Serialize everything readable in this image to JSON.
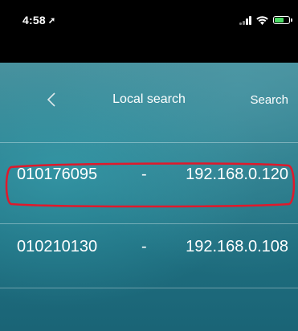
{
  "status_bar": {
    "time": "4:58",
    "location_glyph": "➚",
    "battery_color": "#4cd964"
  },
  "nav": {
    "back_glyph": "<",
    "title": "Local search",
    "search_label": "Search"
  },
  "devices": [
    {
      "id": "010176095",
      "separator": "-",
      "ip": "192.168.0.120"
    },
    {
      "id": "010210130",
      "separator": "-",
      "ip": "192.168.0.108"
    }
  ],
  "highlight": {
    "color": "#e0192b"
  },
  "icons": [
    "location-icon",
    "signal-icon",
    "wifi-icon",
    "battery-icon",
    "back-chevron-icon"
  ]
}
